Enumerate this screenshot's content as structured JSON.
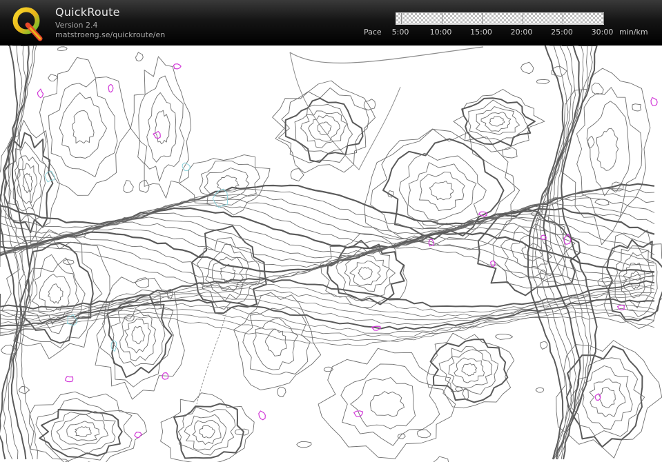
{
  "app": {
    "title": "QuickRoute",
    "version": "Version 2.4",
    "url": "matstroeng.se/quickroute/en",
    "logo_letter": "Q"
  },
  "pace_scale": {
    "label": "Pace",
    "ticks": [
      "5:00",
      "10:00",
      "15:00",
      "20:00",
      "25:00",
      "30:00"
    ],
    "unit": "min/km"
  },
  "map": {
    "contour_color": "#6e6e6e",
    "index_contour_color": "#5a5a5a",
    "marsh_color": "#d23ad8",
    "water_color": "#8fd6df",
    "path_color": "#8c8c8c"
  },
  "colors": {
    "header_bg": "#000000",
    "header_text": "#e6e6e6",
    "header_muted": "#a8a8a8",
    "logo_ring": "#f0c21c",
    "logo_tail": "#58b82b"
  }
}
